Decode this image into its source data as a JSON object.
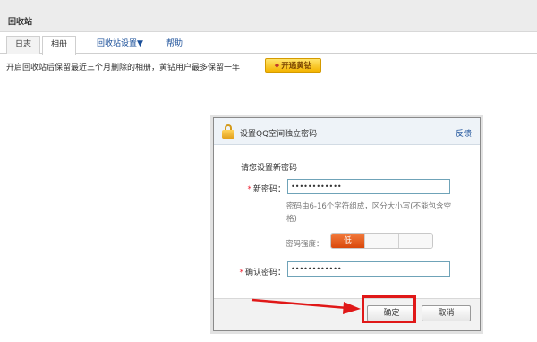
{
  "header": {
    "title": "回收站"
  },
  "tabs": [
    {
      "label": "日志"
    },
    {
      "label": "相册"
    },
    {
      "label": "回收站设置▼"
    },
    {
      "label": "帮助"
    }
  ],
  "notice": {
    "text": "开启回收站后保留最近三个月删除的相册，黄钻用户最多保留一年",
    "vip_button": "开通黄钻",
    "vip_icon": "diamond-icon"
  },
  "dialog": {
    "title": "设置QQ空间独立密码",
    "feedback_link": "反馈",
    "lock_icon": "lock-icon",
    "prompt": "请您设置新密码",
    "new_password": {
      "label": "新密码：",
      "value": "••••••••••••"
    },
    "hint": "密码由6-16个字符组成，区分大小写(不能包含空格)",
    "strength": {
      "label": "密码强度：",
      "level_text": "低",
      "level_fraction": 0.33
    },
    "confirm_password": {
      "label": "确认密码：",
      "value": "••••••••••••"
    },
    "ok_button": "确定",
    "cancel_button": "取消"
  },
  "annotation": {
    "highlight_color": "#e01818"
  }
}
